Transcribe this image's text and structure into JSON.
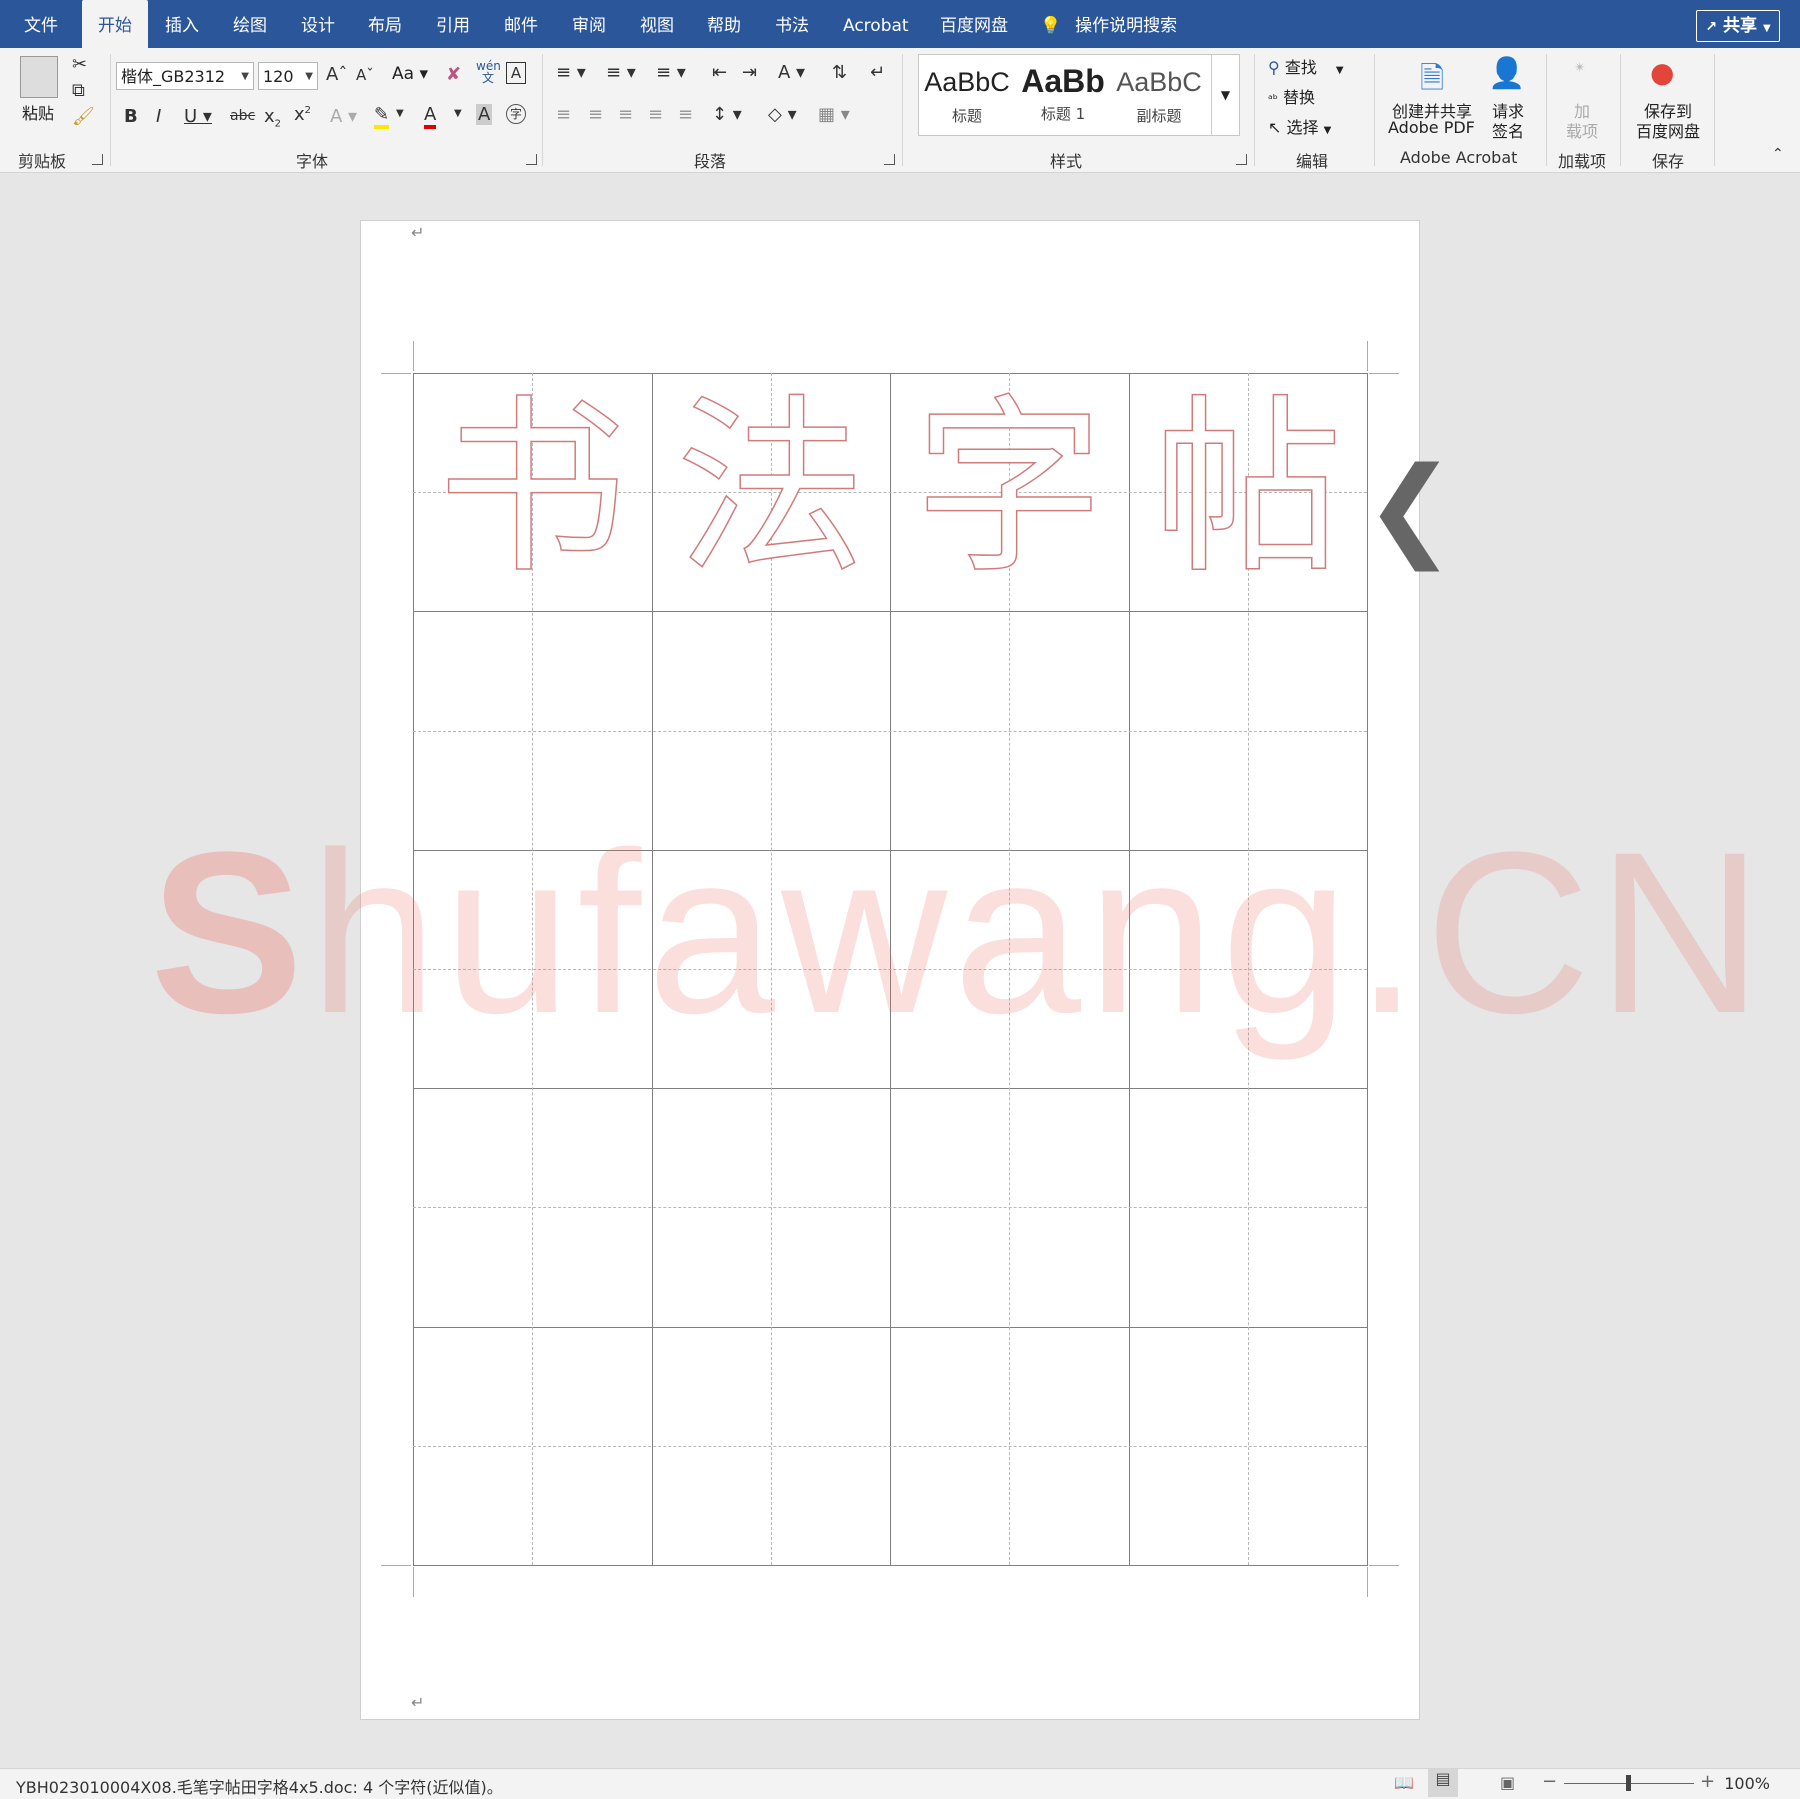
{
  "tabs": [
    "文件",
    "开始",
    "插入",
    "绘图",
    "设计",
    "布局",
    "引用",
    "邮件",
    "审阅",
    "视图",
    "帮助",
    "书法",
    "Acrobat",
    "百度网盘"
  ],
  "active_tab": "开始",
  "tell_me": "操作说明搜索",
  "share_label": "共享",
  "clipboard": {
    "paste": "粘贴",
    "group": "剪贴板"
  },
  "font": {
    "name": "楷体_GB2312",
    "size": "120",
    "case_btn": "Aa",
    "pinyin_btn": "wén文",
    "group": "字体"
  },
  "paragraph": {
    "group": "段落"
  },
  "styles": {
    "items": [
      {
        "preview": "AaBbC",
        "name": "标题"
      },
      {
        "preview": "AaBb",
        "name": "标题 1"
      },
      {
        "preview": "AaBbC",
        "name": "副标题"
      }
    ],
    "group": "样式"
  },
  "editing": {
    "find": "查找",
    "replace": "替换",
    "select": "选择",
    "group": "编辑"
  },
  "acrobat": {
    "create_share": "创建并共享",
    "create_share_2": "Adobe PDF",
    "request": "请求",
    "request_2": "签名",
    "group": "Adobe Acrobat"
  },
  "addins": {
    "label_1": "加",
    "label_2": "载项",
    "group": "加载项"
  },
  "save": {
    "label_1": "保存到",
    "label_2": "百度网盘",
    "group": "保存"
  },
  "document": {
    "characters": [
      "书",
      "法",
      "字",
      "帖"
    ],
    "watermark": "Shufawang.CN",
    "grid_rows": 5,
    "grid_cols": 4
  },
  "status": {
    "text": "YBH023010004X08.毛笔字帖田字格4x5.doc: 4 个字符(近似值)。",
    "zoom": "100%"
  },
  "colors": {
    "word_blue": "#2b579a",
    "char_outline": "#d17a7a",
    "watermark": "#eb6e5f"
  }
}
